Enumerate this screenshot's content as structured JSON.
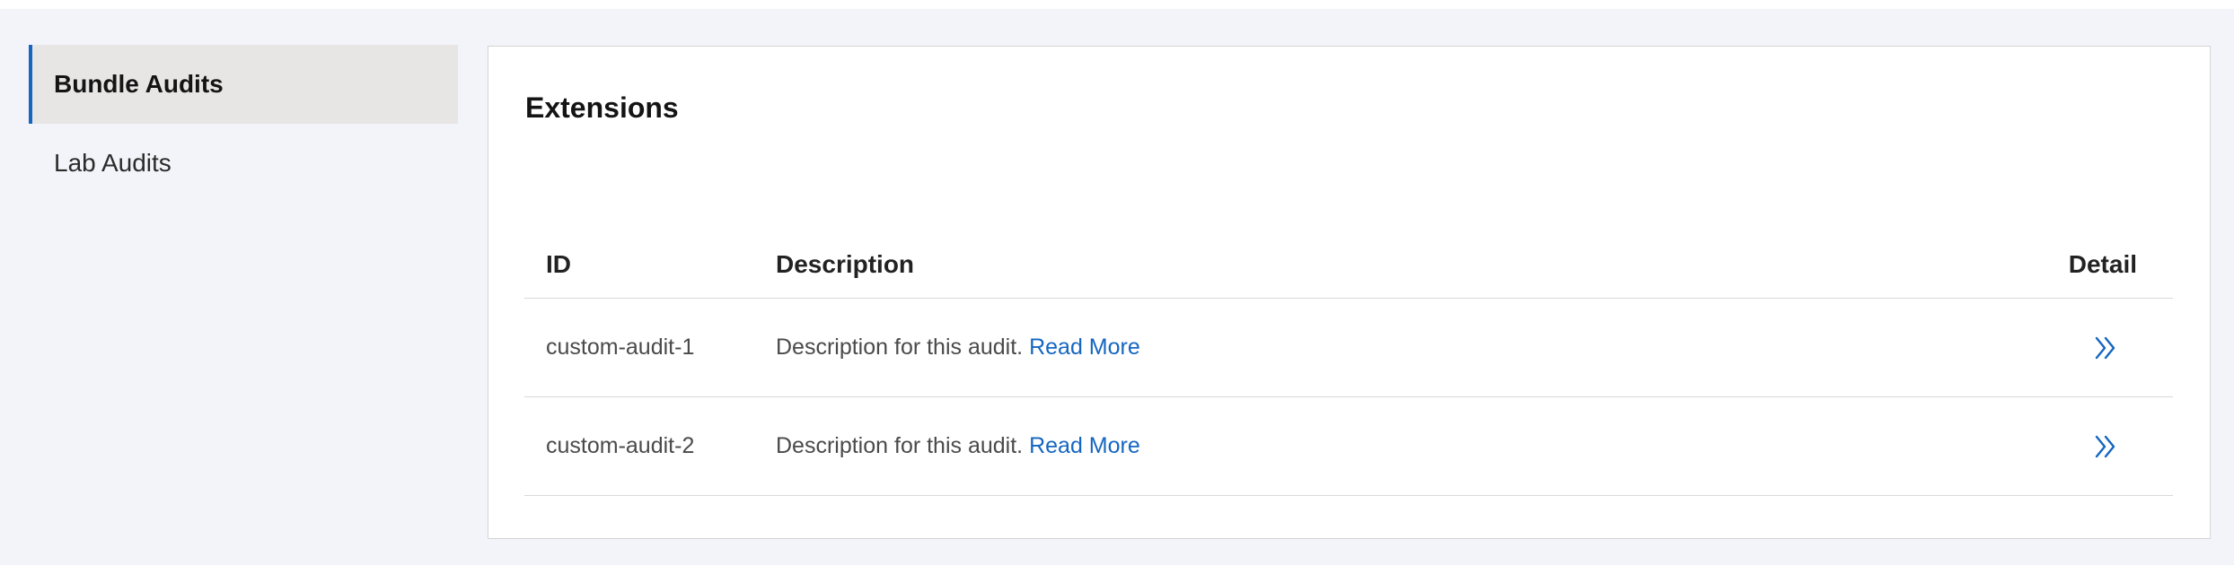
{
  "sidebar": {
    "items": [
      {
        "label": "Bundle Audits",
        "active": true
      },
      {
        "label": "Lab Audits",
        "active": false
      }
    ]
  },
  "main": {
    "title": "Extensions",
    "table": {
      "headers": {
        "id": "ID",
        "description": "Description",
        "detail": "Detail"
      },
      "rows": [
        {
          "id": "custom-audit-1",
          "description": "Description for this audit.",
          "link": "Read More",
          "detail_icon": "double-chevron-right-icon"
        },
        {
          "id": "custom-audit-2",
          "description": "Description for this audit.",
          "link": "Read More",
          "detail_icon": "double-chevron-right-icon"
        }
      ]
    }
  },
  "colors": {
    "accent": "#1566c0",
    "page_bg": "#f3f4f9",
    "active_item_bg": "#e7e6e5"
  }
}
